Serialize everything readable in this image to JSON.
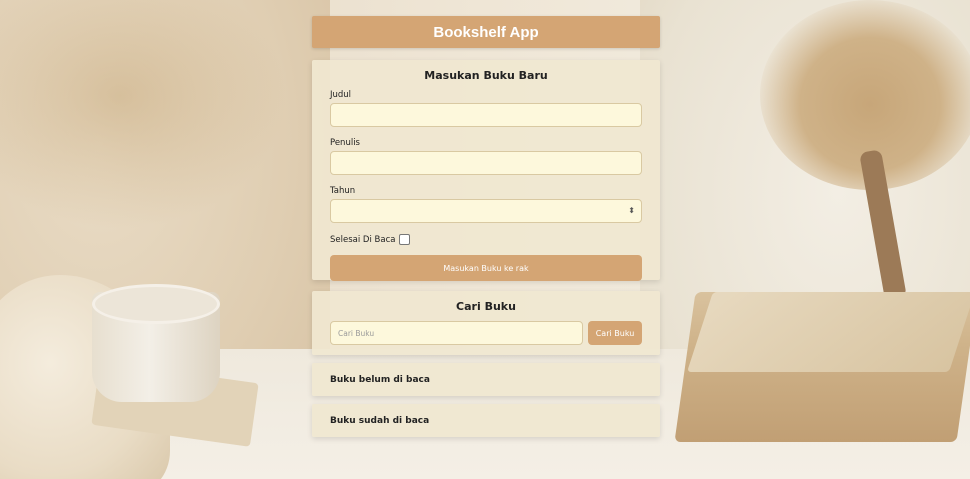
{
  "header": {
    "title": "Bookshelf App"
  },
  "form": {
    "title": "Masukan Buku Baru",
    "fields": {
      "title_label": "Judul",
      "author_label": "Penulis",
      "year_label": "Tahun"
    },
    "checkbox_label": "Selesai Di Baca",
    "checkbox_checked": false,
    "submit_label": "Masukan Buku ke rak"
  },
  "search": {
    "title": "Cari Buku",
    "placeholder": "Cari Buku",
    "button_label": "Cari Buku"
  },
  "shelves": {
    "unread_title": "Buku belum di baca",
    "read_title": "Buku sudah di baca"
  },
  "colors": {
    "accent": "#d4a574",
    "input_bg": "#fdf8dc",
    "card_bg": "#f0e7d1"
  }
}
